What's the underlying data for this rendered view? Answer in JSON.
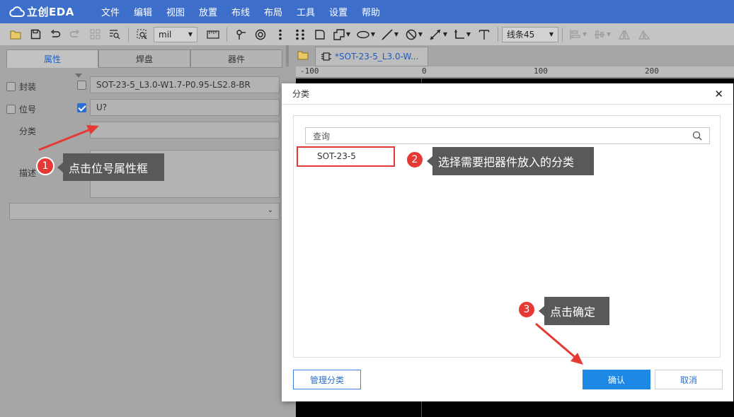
{
  "app": {
    "logo_text": "立创EDA",
    "menu": [
      "文件",
      "编辑",
      "视图",
      "放置",
      "布线",
      "布局",
      "工具",
      "设置",
      "帮助"
    ]
  },
  "toolbar": {
    "unit_value": "mil",
    "line_mode_value": "线条45",
    "icons": [
      "folder-icon",
      "save-icon",
      "undo-icon",
      "redo-icon",
      "grid-icon",
      "zoom-list-icon",
      "zoom-select-icon",
      "ruler-icon",
      "pin-icon",
      "pad-icon",
      "via-icon",
      "multi-via-icon",
      "rect-icon",
      "polygon-icon",
      "ellipse-icon",
      "line-icon",
      "no-icon",
      "dimension-icon",
      "corner-icon",
      "text-icon",
      "align-icon",
      "distribute-icon",
      "flip-h-icon",
      "flip-v-icon"
    ]
  },
  "left_panel": {
    "tabs": [
      "属性",
      "焊盘",
      "器件"
    ],
    "active_tab": "属性",
    "package_label": "封装",
    "package_value": "SOT-23-5_L3.0-W1.7-P0.95-LS2.8-BR",
    "designator_label": "位号",
    "designator_value": "U?",
    "category_label": "分类",
    "category_value": "",
    "description_label": "描述",
    "description_value": ""
  },
  "document": {
    "tab_title": "*SOT-23-5_L3.0-W...",
    "ruler_labels": [
      "-100",
      "0",
      "100",
      "200"
    ]
  },
  "dialog": {
    "title": "分类",
    "search_placeholder": "查询",
    "categories": [
      "SOT-23-5"
    ],
    "manage_button": "管理分类",
    "ok_button": "确认",
    "cancel_button": "取消"
  },
  "annotations": [
    {
      "number": "1",
      "text": "点击位号属性框"
    },
    {
      "number": "2",
      "text": "选择需要把器件放入的分类"
    },
    {
      "number": "3",
      "text": "点击确定"
    }
  ],
  "colors": {
    "menubar": "#3d6fca",
    "badge": "#e53935",
    "callout": "#595959",
    "primary_button": "#1e88e5"
  }
}
